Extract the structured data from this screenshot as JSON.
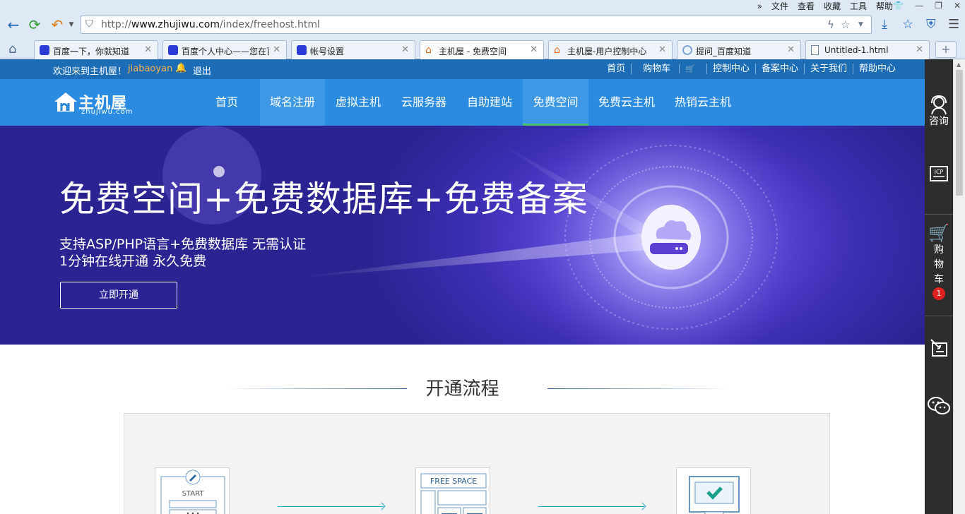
{
  "browser": {
    "menu": [
      "文件",
      "查看",
      "收藏",
      "工具",
      "帮助"
    ],
    "address": {
      "prefix": "http://",
      "host": "www.zhujiwu.com",
      "path": "/index/freehost.html"
    },
    "tabs": [
      {
        "title": "百度一下，你就知道",
        "icon": "baidu-paw-icon"
      },
      {
        "title": "百度个人中心——您在百",
        "icon": "baidu-paw-icon"
      },
      {
        "title": "帐号设置",
        "icon": "baidu-paw-icon"
      },
      {
        "title": "主机屋 - 免费空间",
        "icon": "house-icon"
      },
      {
        "title": "主机屋-用户控制中心",
        "icon": "house-icon"
      },
      {
        "title": "提问_百度知道",
        "icon": "loading-icon"
      },
      {
        "title": "Untitled-1.html",
        "icon": "document-icon"
      }
    ]
  },
  "site": {
    "welcome": "欢迎来到主机屋！",
    "username": "jiabaoyan",
    "logout": "退出",
    "toplinks": [
      "首页",
      "购物车",
      "控制中心",
      "备案中心",
      "关于我们",
      "帮助中心"
    ],
    "logo": {
      "name": "主机屋",
      "domain": "zhujiwu.com"
    },
    "nav": [
      "首页",
      "域名注册",
      "虚拟主机",
      "云服务器",
      "自助建站",
      "免费空间",
      "免费云主机",
      "热销云主机"
    ],
    "banner": {
      "headline": "免费空间+免费数据库+免费备案",
      "line1": "支持ASP/PHP语言+免费数据库 无需认证",
      "line2": "1分钟在线开通 永久免费",
      "cta": "立即开通"
    },
    "section_title": "开通流程",
    "flow_cards": {
      "start": "START",
      "free_space": "FREE SPACE"
    }
  },
  "sidebar": {
    "consult": "咨询",
    "icp": "ICP",
    "cart": [
      "购",
      "物",
      "车"
    ],
    "cart_count": "1"
  },
  "colors": {
    "topbar": "#1d6db6",
    "nav": "#2b8be0",
    "active_underline": "#47c26b",
    "banner": "#3c2eb4",
    "username": "#f7b24a"
  }
}
